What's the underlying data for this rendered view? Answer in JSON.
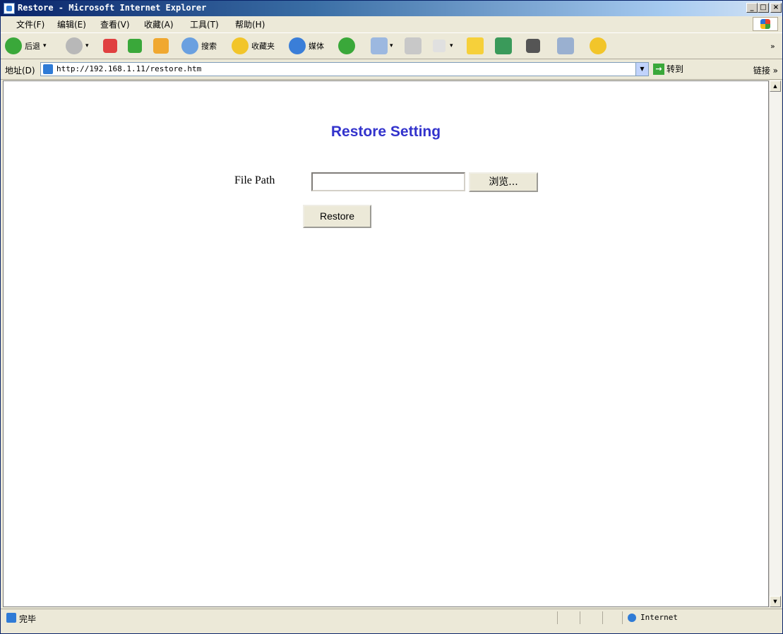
{
  "window": {
    "title": "Restore - Microsoft Internet Explorer",
    "buttons": {
      "minimize": "_",
      "maximize": "□",
      "close": "×"
    }
  },
  "menu": [
    "文件(F)",
    "编辑(E)",
    "查看(V)",
    "收藏(A)",
    "工具(T)",
    "帮助(H)"
  ],
  "toolbar": {
    "back_label": "后退",
    "search_label": "搜索",
    "favorites_label": "收藏夹",
    "media_label": "媒体"
  },
  "address": {
    "label": "地址(D)",
    "url": "http://192.168.1.11/restore.htm",
    "go_label": "转到",
    "links_label": "链接 »"
  },
  "page": {
    "title": "Restore Setting",
    "file_path_label": "File Path",
    "file_path_value": "",
    "browse_label": "浏览...",
    "restore_label": "Restore"
  },
  "status": {
    "text": "完毕",
    "zone": "Internet"
  }
}
